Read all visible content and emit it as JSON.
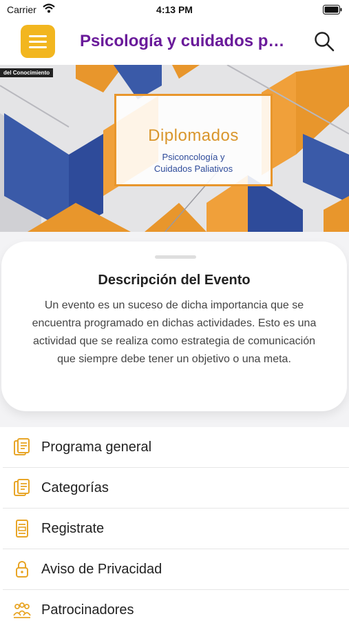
{
  "status_bar": {
    "carrier": "Carrier",
    "time": "4:13 PM"
  },
  "header": {
    "title": "Psicología y cuidados paliativos"
  },
  "banner": {
    "tag": "del Conocimiento",
    "title": "Diplomados",
    "subtitle_line1": "Psiconcología y",
    "subtitle_line2": "Cuidados Paliativos"
  },
  "description": {
    "title": "Descripción del Evento",
    "text": "Un evento es un suceso de dicha importancia que se encuentra programado en dichas actividades. Esto es una actividad que se realiza como estrategia de comunicación que siempre debe tener un objetivo o una meta."
  },
  "menu": {
    "items": [
      {
        "label": "Programa general",
        "icon": "document-icon"
      },
      {
        "label": "Categorías",
        "icon": "document-icon"
      },
      {
        "label": "Registrate",
        "icon": "form-icon"
      },
      {
        "label": "Aviso de Privacidad",
        "icon": "lock-icon"
      },
      {
        "label": "Patrocinadores",
        "icon": "group-icon"
      }
    ]
  },
  "colors": {
    "accent": "#f2b61f",
    "title": "#6a1b9a",
    "banner_orange": "#e8962c",
    "banner_blue": "#2e4b9a"
  }
}
